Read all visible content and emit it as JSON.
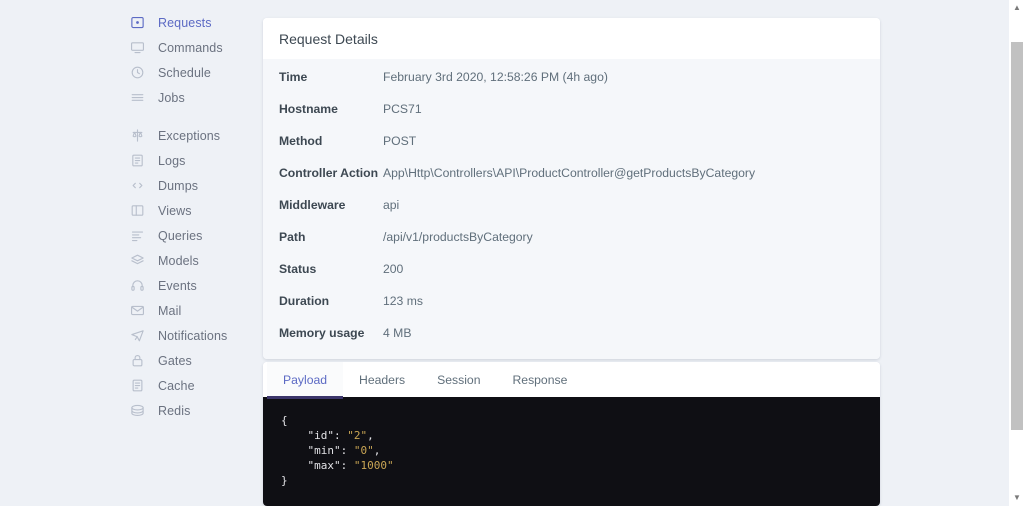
{
  "sidebar": {
    "groups": [
      {
        "items": [
          {
            "label": "Requests",
            "icon": "requests-icon",
            "active": true
          },
          {
            "label": "Commands",
            "icon": "commands-icon",
            "active": false
          },
          {
            "label": "Schedule",
            "icon": "schedule-icon",
            "active": false
          },
          {
            "label": "Jobs",
            "icon": "jobs-icon",
            "active": false
          }
        ]
      },
      {
        "items": [
          {
            "label": "Exceptions",
            "icon": "exceptions-icon",
            "active": false
          },
          {
            "label": "Logs",
            "icon": "logs-icon",
            "active": false
          },
          {
            "label": "Dumps",
            "icon": "dumps-icon",
            "active": false
          },
          {
            "label": "Views",
            "icon": "views-icon",
            "active": false
          },
          {
            "label": "Queries",
            "icon": "queries-icon",
            "active": false
          },
          {
            "label": "Models",
            "icon": "models-icon",
            "active": false
          },
          {
            "label": "Events",
            "icon": "events-icon",
            "active": false
          },
          {
            "label": "Mail",
            "icon": "mail-icon",
            "active": false
          },
          {
            "label": "Notifications",
            "icon": "notifications-icon",
            "active": false
          },
          {
            "label": "Gates",
            "icon": "gates-icon",
            "active": false
          },
          {
            "label": "Cache",
            "icon": "cache-icon",
            "active": false
          },
          {
            "label": "Redis",
            "icon": "redis-icon",
            "active": false
          }
        ]
      }
    ]
  },
  "details": {
    "title": "Request Details",
    "rows": [
      {
        "key": "Time",
        "value": "February 3rd 2020, 12:58:26 PM (4h ago)"
      },
      {
        "key": "Hostname",
        "value": "PCS71"
      },
      {
        "key": "Method",
        "value": "POST"
      },
      {
        "key": "Controller Action",
        "value": "App\\Http\\Controllers\\API\\ProductController@getProductsByCategory"
      },
      {
        "key": "Middleware",
        "value": "api"
      },
      {
        "key": "Path",
        "value": "/api/v1/productsByCategory"
      },
      {
        "key": "Status",
        "value": "200"
      },
      {
        "key": "Duration",
        "value": "123 ms"
      },
      {
        "key": "Memory usage",
        "value": "4 MB"
      }
    ]
  },
  "payload": {
    "tabs": [
      {
        "label": "Payload",
        "active": true
      },
      {
        "label": "Headers",
        "active": false
      },
      {
        "label": "Session",
        "active": false
      },
      {
        "label": "Response",
        "active": false
      }
    ],
    "code": {
      "open_brace": "{",
      "close_brace": "}",
      "entries": [
        {
          "key": "\"id\"",
          "value": "\"2\"",
          "comma": ","
        },
        {
          "key": "\"min\"",
          "value": "\"0\"",
          "comma": ","
        },
        {
          "key": "\"max\"",
          "value": "\"1000\"",
          "comma": ""
        }
      ]
    }
  },
  "colors": {
    "accent": "#5c6ac4",
    "accent_dark": "#3c366b",
    "page_bg": "#eef1f6",
    "table_bg": "#f5f7fa",
    "code_bg": "#0f0f14",
    "code_value": "#c9a554"
  },
  "scrollbar": {
    "up_arrow": "▲",
    "down_arrow": "▼"
  }
}
